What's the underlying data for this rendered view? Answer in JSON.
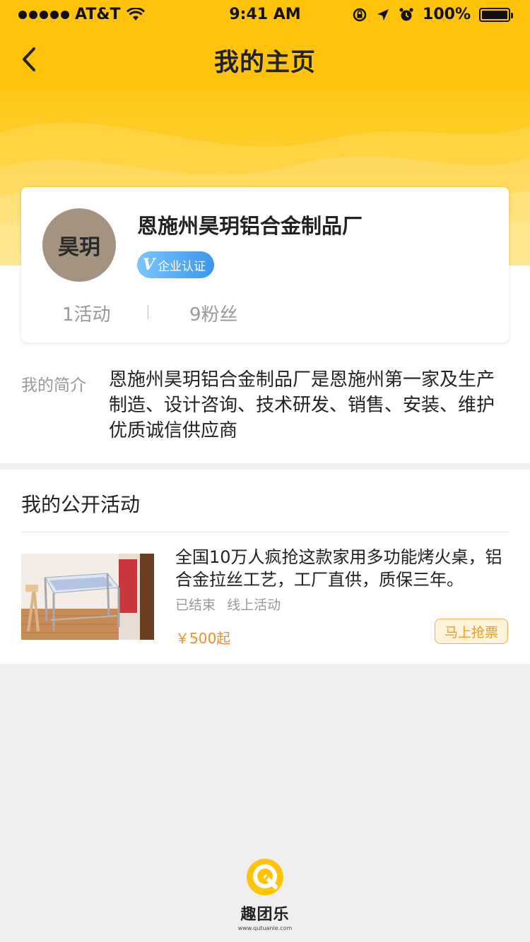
{
  "status_bar": {
    "carrier": "AT&T",
    "time": "9:41 AM",
    "battery": "100%"
  },
  "nav": {
    "title": "我的主页"
  },
  "profile": {
    "avatar_text": "昊玥",
    "name": "恩施州昊玥铝合金制品厂",
    "badge_text": "企业认证",
    "activities": "1活动",
    "fans": "9粉丝"
  },
  "intro": {
    "label": "我的简介",
    "text": "恩施州昊玥铝合金制品厂是恩施州第一家及生产制造、设计咨询、技术研发、销售、安装、维护优质诚信供应商"
  },
  "public_activities": {
    "title": "我的公开活动",
    "items": [
      {
        "title": "全国10万人疯抢这款家用多功能烤火桌，铝合金拉丝工艺，工厂直供，质保三年。",
        "status": "已结束",
        "type": "线上活动",
        "price": "￥500起",
        "button": "马上抢票"
      }
    ]
  },
  "brand": {
    "name": "趣团乐",
    "url": "www.qutuanle.com"
  },
  "colors": {
    "header": "#ffc40a",
    "accent": "#f0902a",
    "badge": "#3a96ee"
  }
}
